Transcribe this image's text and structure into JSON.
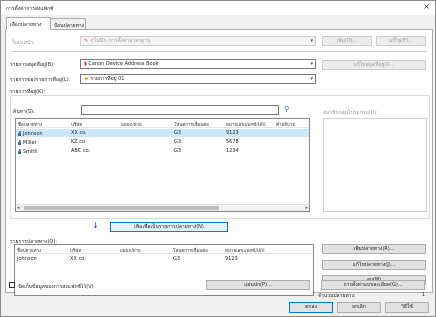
{
  "window": {
    "title": "การตั้งค่าการส่งแฟกซ์"
  },
  "tabs": [
    {
      "label": "เลือกปลายทาง"
    },
    {
      "label": "ป้อนปลายทาง"
    }
  ],
  "cover_sheet": {
    "label": "ใบปะหน้า:",
    "value": "<ไม่มี> การตั้งค่ามาตรฐาน",
    "add_button": "เพิ่ม(D)...",
    "edit_button": "แก้ไข(E)..."
  },
  "address_book": {
    "label": "รายการสมุดที่อยู่(B):",
    "value": "Canon Device Address Book",
    "extra_button": "แก้ไขสมุดที่อยู่(I)...",
    "address_list_label": "รายการของรายการที่อยู่(L):",
    "address_list_value": "รายการที่อยู่ 01",
    "list_label": "รายการที่อยู่(K):"
  },
  "search": {
    "label": "ค้นหา(S):",
    "value": "",
    "icon": "search-icon"
  },
  "right_panel_label": "สมาชิกกลุ่มโปรแกรม(U):",
  "address_table": {
    "columns": [
      "ชื่อปลายทาง",
      "บริษัท",
      "แผนก/ฝ่าย",
      "โหมดการเชื่อมต่อ",
      "หมายเลขแฟกซ์/URI",
      "คำอธิบาย"
    ],
    "rows": [
      {
        "name": "Johnson",
        "company": "XX co.",
        "dept": "",
        "mode": "G3",
        "number": "9123",
        "desc": ""
      },
      {
        "name": "Miller",
        "company": "KZ co.",
        "dept": "",
        "mode": "G3",
        "number": "5678",
        "desc": ""
      },
      {
        "name": "Smith",
        "company": "ABC co.",
        "dept": "",
        "mode": "G3",
        "number": "1234",
        "desc": ""
      }
    ]
  },
  "add_to_dest_button": "เพิ่มเพื่อเป็นรายการปลายทาง(N)",
  "destination": {
    "label": "รายการปลายทาง(Q):",
    "columns": [
      "ชื่อปลายทาง",
      "บริษัท",
      "แผนก/ฝ่าย",
      "โหมดการเชื่อมต่อ",
      "หมายเลขแฟกซ์/URI"
    ],
    "rows": [
      {
        "name": "Johnson",
        "company": "XX co.",
        "dept": "",
        "mode": "G3",
        "number": "9123"
      }
    ],
    "add_button": "เพิ่มปลายทาง(R)...",
    "edit_button": "แก้ไขปลายทาง(J)...",
    "delete_button": "ลบ(M)",
    "count_label": "จำนวนปลายทาง:",
    "count_value": "1"
  },
  "footer": {
    "checkbox_label": "จัดเก็บข้อมูลของการส่งแฟกซ์ไว้(V)",
    "middle_button": "แผ่นปก(P)...",
    "right_button": "การตั้งค่าแบบละเอียด(G)...",
    "ok": "ตกลง",
    "cancel": "ยกเลิก",
    "help": "วิธีใช้"
  }
}
